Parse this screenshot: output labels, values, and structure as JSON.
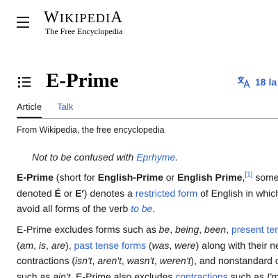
{
  "header": {
    "logo_title_first": "W",
    "logo_title_rest": "IKIPEDI",
    "logo_title_last": "A",
    "logo_tagline": "The Free Encyclopedia"
  },
  "page": {
    "title": "E-Prime",
    "language_button": "18 la",
    "tabs": [
      "Article",
      "Talk"
    ],
    "from_line": "From Wikipedia, the free encyclopedia"
  },
  "hatnote": {
    "prefix": "Not to be confused with ",
    "link": "Eprhyme",
    "suffix": "."
  },
  "paragraph1": {
    "l1_bold": "E-Prime",
    "l1_t1": " (short for ",
    "l1_bold2": "English-Prime",
    "l1_t2": " or ",
    "l1_bold3": "English Prime",
    "l1_t3": ",",
    "l1_ref": "[1]",
    "l1_t4": " some",
    "l2_t1": "denoted ",
    "l2_bold1": "É",
    "l2_t2": " or ",
    "l2_bold2": "E′",
    "l2_t3": ") denotes a ",
    "l2_link": "restricted form",
    "l2_t4": " of English in which",
    "l3_t1": "avoid all forms of the verb ",
    "l3_link": "to be",
    "l3_t2": "."
  },
  "paragraph2": {
    "l1_t1": "E-Prime excludes forms such as ",
    "l1_i1": "be",
    "l1_t2": ", ",
    "l1_i2": "being",
    "l1_t3": ", ",
    "l1_i3": "been",
    "l1_t4": ", ",
    "l1_link": "present ter",
    "l2_t1": "(",
    "l2_i1": "am",
    "l2_t2": ", ",
    "l2_i2": "is",
    "l2_t3": ", ",
    "l2_i3": "are",
    "l2_t4": "), ",
    "l2_link": "past tense forms",
    "l2_t5": " (",
    "l2_i4": "was",
    "l2_t6": ", ",
    "l2_i5": "were",
    "l2_t7": ") along with their ne",
    "l3_t1": "contractions (",
    "l3_i1": "isn't",
    "l3_t2": ", ",
    "l3_i2": "aren't",
    "l3_t3": ", ",
    "l3_i3": "wasn't",
    "l3_t4": ", ",
    "l3_i4": "weren't",
    "l3_t5": "), and nonstandard c",
    "l4_t1": "such as ",
    "l4_i1": "ain't",
    "l4_t2": ". E-Prime also excludes ",
    "l4_link": "contractions",
    "l4_t3": " such as ",
    "l4_i2": "I'm"
  }
}
